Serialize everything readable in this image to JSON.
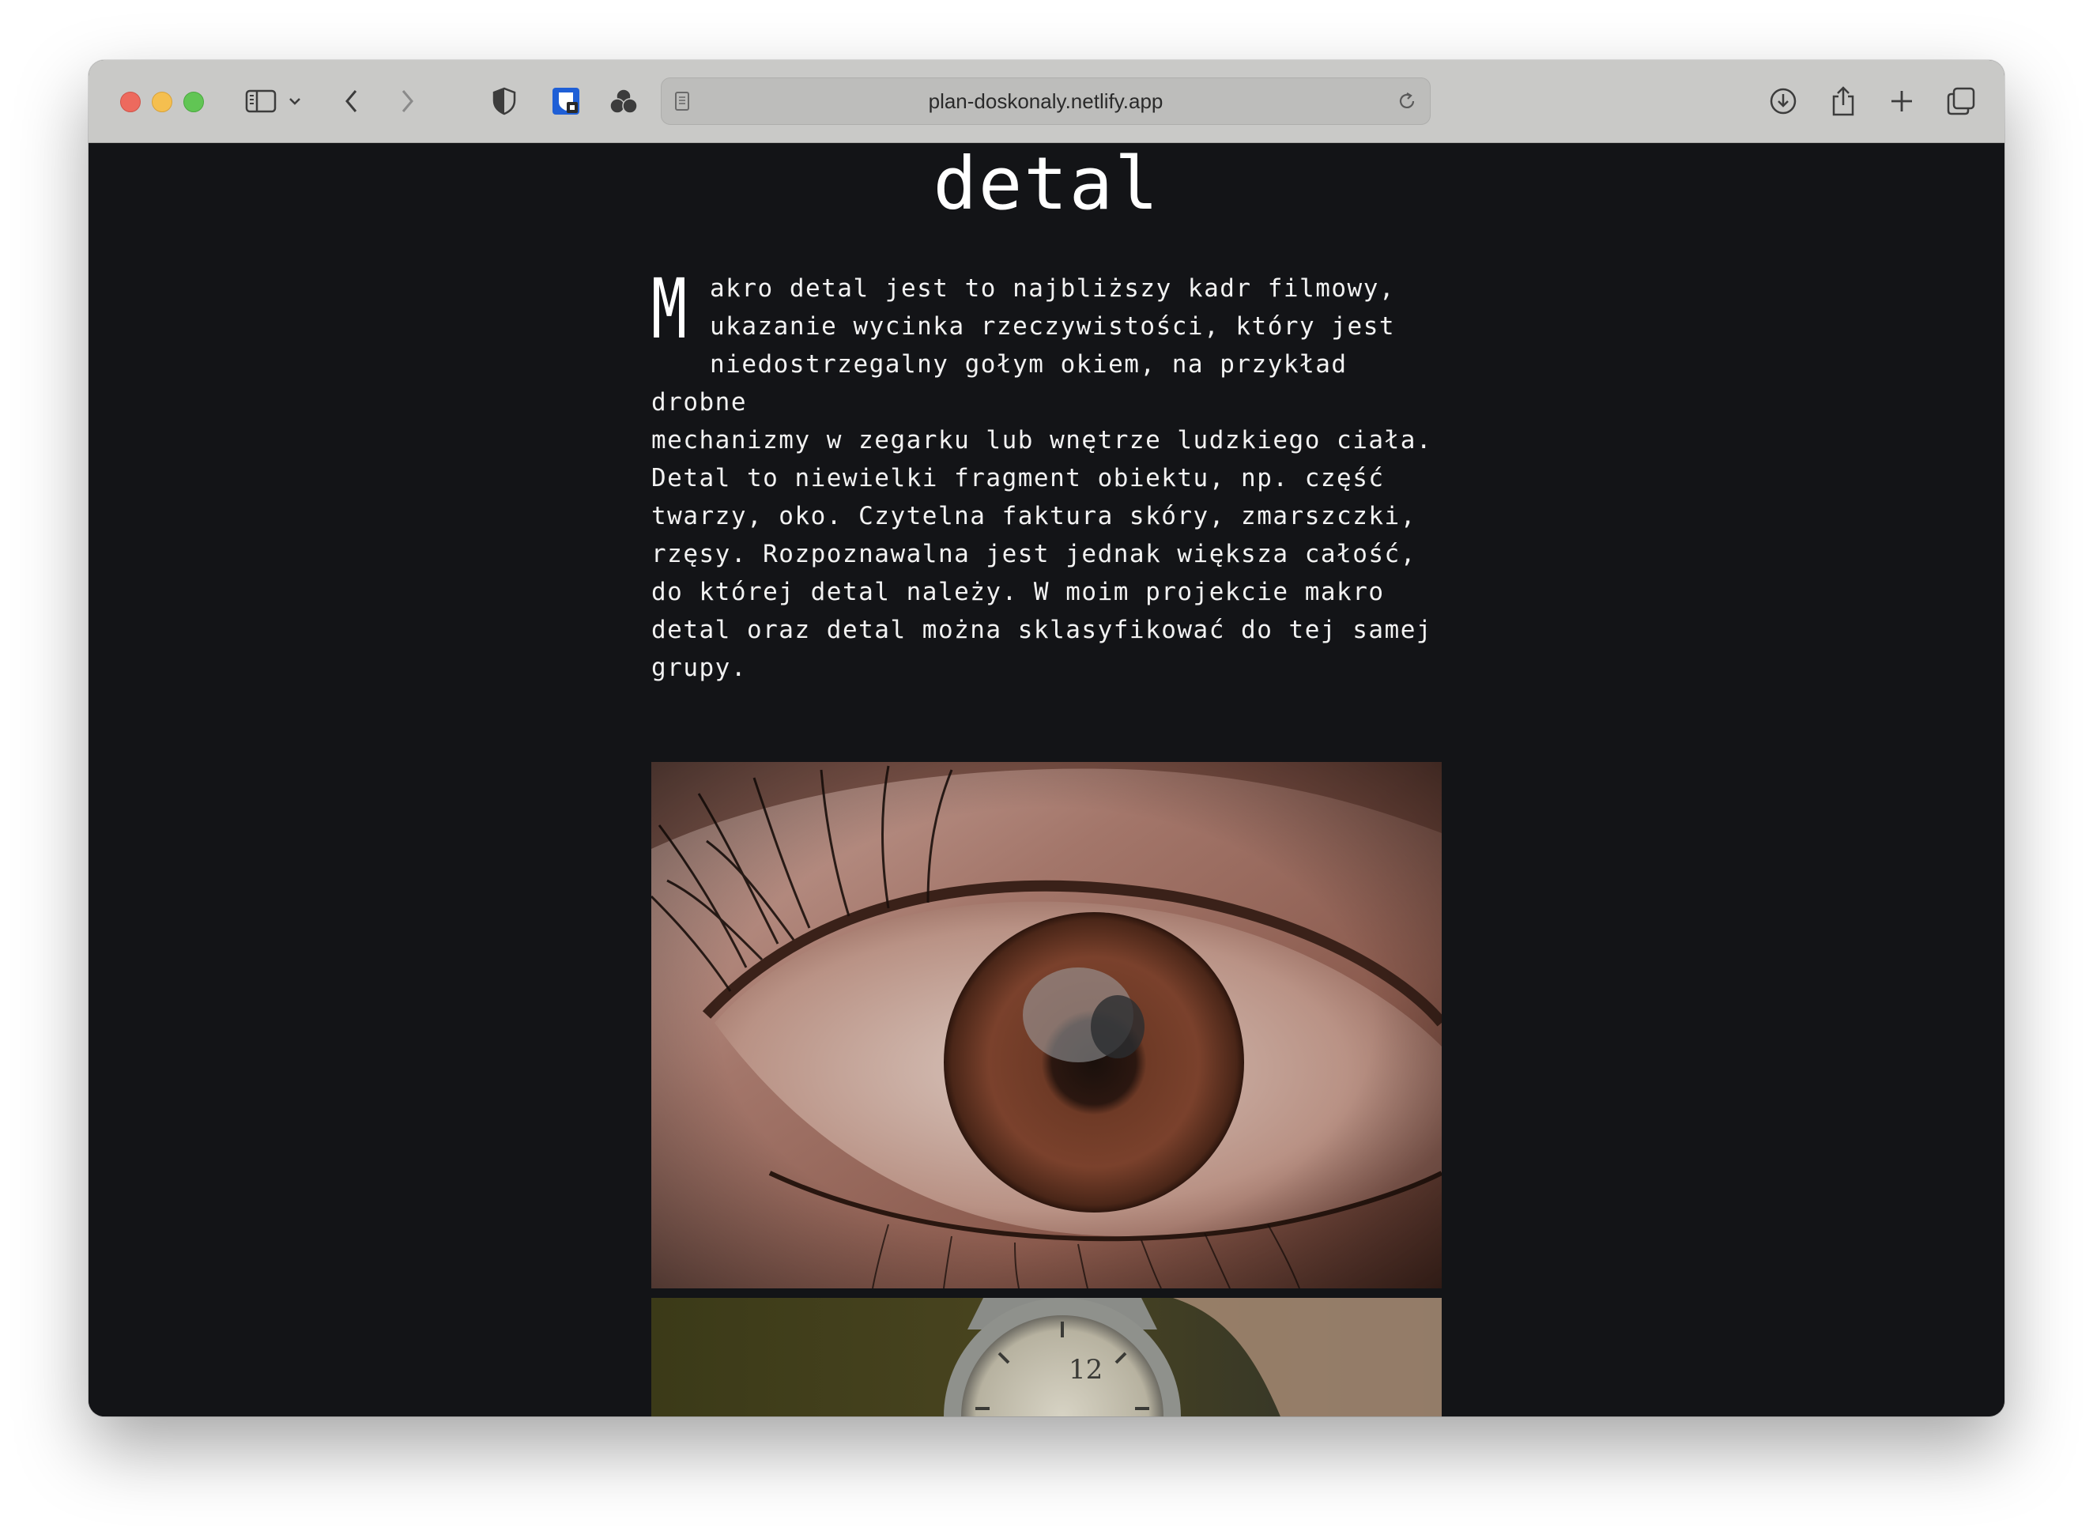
{
  "browser": {
    "url": "plan-doskonaly.netlify.app",
    "icons": {
      "sidebar": "sidebar-icon",
      "sidebar_menu": "chevron-down-icon",
      "back": "chevron-left-icon",
      "forward": "chevron-right-icon",
      "privacy": "shield-icon",
      "extension_1": "bitwarden-icon",
      "extension_2": "tricolor-icon",
      "page": "page-icon",
      "reload": "reload-icon",
      "downloads": "download-icon",
      "share": "share-icon",
      "new_tab": "plus-icon",
      "tabs_overview": "tabs-icon"
    }
  },
  "article": {
    "heading": "detal",
    "paragraph1_dropcap": "M",
    "paragraph1_rest": "akro detal jest to najbliższy kadr filmowy,\nukazanie wycinka rzeczywistości, który jest\nniedostrzegalny gołym okiem, na przykład drobne\nmechanizmy w zegarku lub wnętrze ludzkiego ciała.",
    "paragraph2": "Detal to niewielki fragment obiektu, np. część\ntwarzy, oko. Czytelna faktura skóry, zmarszczki,\nrzęsy. Rozpoznawalna jest jednak większa całość,\ndo której detal należy. W moim projekcie makro\ndetal oraz detal można sklasyfikować do tej samej\ngrupy.",
    "images": [
      "eye-closeup",
      "wristwatch"
    ]
  },
  "colors": {
    "page_background": "#131417",
    "toolbar_background": "#c9c9c7",
    "text": "#f2f2f2"
  }
}
